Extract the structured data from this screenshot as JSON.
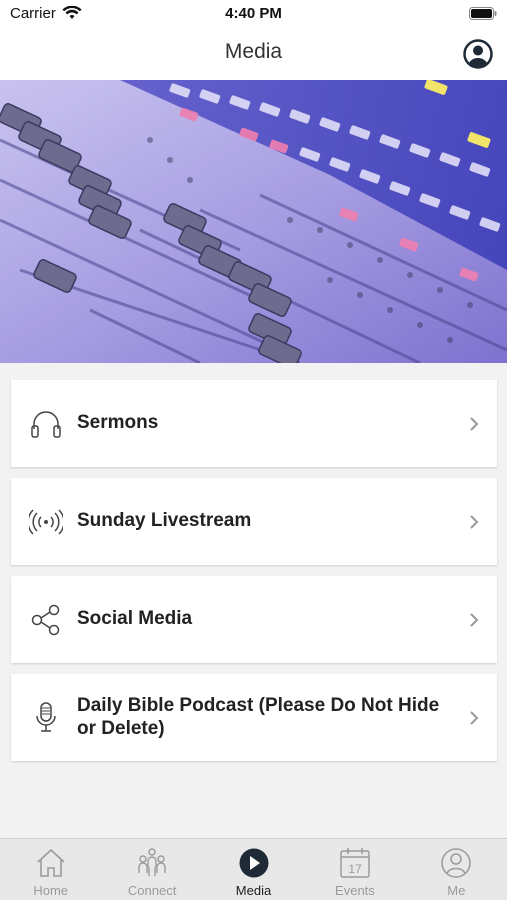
{
  "status_bar": {
    "carrier": "Carrier",
    "time": "4:40 PM"
  },
  "nav": {
    "title": "Media",
    "profile_icon": "user-circle-icon"
  },
  "hero": {
    "description_icon": "mixing-console-photo"
  },
  "menu": {
    "items": [
      {
        "label": "Sermons",
        "icon": "headphones-icon"
      },
      {
        "label": "Sunday Livestream",
        "icon": "broadcast-icon"
      },
      {
        "label": "Social Media",
        "icon": "share-icon"
      },
      {
        "label": "Daily Bible Podcast (Please Do Not Hide or Delete)",
        "icon": "microphone-icon"
      }
    ]
  },
  "tabs": [
    {
      "label": "Home",
      "icon": "home-icon",
      "active": false
    },
    {
      "label": "Connect",
      "icon": "people-icon",
      "active": false
    },
    {
      "label": "Media",
      "icon": "play-icon",
      "active": true
    },
    {
      "label": "Events",
      "icon": "calendar-icon",
      "active": false,
      "calendar_day": "17"
    },
    {
      "label": "Me",
      "icon": "user-icon",
      "active": false
    }
  ],
  "colors": {
    "hero_tint": "#8b7fd6",
    "active_tab": "#1e2a36",
    "inactive_tab": "#9a9a9a"
  }
}
